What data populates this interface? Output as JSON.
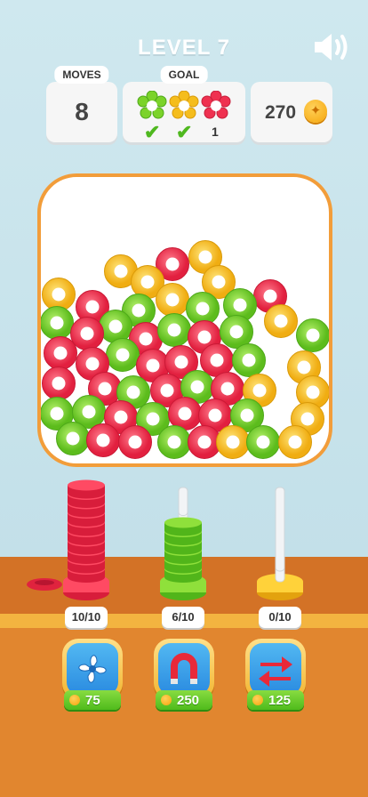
{
  "header": {
    "level_title": "LEVEL 7"
  },
  "moves": {
    "label": "MOVES",
    "value": "8"
  },
  "goal": {
    "label": "GOAL",
    "items": [
      {
        "color": "green",
        "hex": "#7bd32a",
        "status": "done"
      },
      {
        "color": "yellow",
        "hex": "#f5bd1c",
        "status": "done"
      },
      {
        "color": "red",
        "hex": "#ef3150",
        "remaining": "1"
      }
    ]
  },
  "points": {
    "value": "270"
  },
  "colors": {
    "red": "#ef3150",
    "green": "#86d83d",
    "yellow": "#f7c62c",
    "orange_border": "#f29d3a"
  },
  "stacks": [
    {
      "color": "red",
      "count_label": "10/10",
      "filled": 10,
      "capacity": 10
    },
    {
      "color": "green",
      "count_label": "6/10",
      "filled": 6,
      "capacity": 10
    },
    {
      "color": "yellow",
      "count_label": "0/10",
      "filled": 0,
      "capacity": 10
    }
  ],
  "boosters": [
    {
      "icon": "fan-icon",
      "price": "75"
    },
    {
      "icon": "magnet-icon",
      "price": "250"
    },
    {
      "icon": "swap-arrows-icon",
      "price": "125"
    }
  ]
}
